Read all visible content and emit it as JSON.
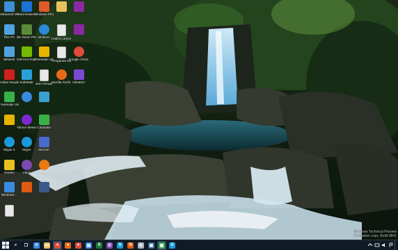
{
  "desktop": {
    "icons": [
      {
        "label": "Mohamed Ghoneim",
        "icon": "user-folder-icon",
        "color": "#3d8fd8"
      },
      {
        "label": "TeamViewer 10",
        "icon": "teamviewer-icon",
        "color": "#1b72d4"
      },
      {
        "label": "Windows Photo Viewer",
        "icon": "photo-viewer-icon",
        "color": "#e05a2a"
      },
      {
        "label": "",
        "icon": "folder-icon",
        "color": "#e8c25a"
      },
      {
        "label": "",
        "icon": "winrar-icon",
        "color": "#8a2aa0"
      },
      {
        "label": "This PC",
        "icon": "computer-icon",
        "color": "#4fa3e0"
      },
      {
        "label": "3D Vision Photo Viewer",
        "icon": "nvidia-3d-icon",
        "color": "#5a8a3a"
      },
      {
        "label": "nimbuzz",
        "icon": "nimbuzz-icon",
        "color": "#2a8ad8"
      },
      {
        "label": "Hadist Lampiran",
        "icon": "document-icon",
        "color": "#e8e8e8"
      },
      {
        "label": "",
        "icon": "winrar-icon",
        "color": "#8a2aa0"
      },
      {
        "label": "Network",
        "icon": "network-icon",
        "color": "#4fa3e0"
      },
      {
        "label": "GeForce Experience",
        "icon": "geforce-icon",
        "color": "#76b900"
      },
      {
        "label": "Freemake Video Co...",
        "icon": "freemake-icon",
        "color": "#e8b400"
      },
      {
        "label": "Pengantar Dakwa",
        "icon": "document-icon",
        "color": "#e8e8e8"
      },
      {
        "label": "Google Chrome",
        "icon": "chrome-icon",
        "color": "#dd4b39"
      },
      {
        "label": "Adobe Reader XI",
        "icon": "adobe-reader-icon",
        "color": "#d01f1f"
      },
      {
        "label": "SnibMale",
        "icon": "app-icon",
        "color": "#2aa0d8"
      },
      {
        "label": "Jam Ahmad",
        "icon": "document-icon",
        "color": "#e8e8e8"
      },
      {
        "label": "Mozilla Firefox",
        "icon": "firefox-icon",
        "color": "#e66a1a"
      },
      {
        "label": "UltraISO",
        "icon": "ultraiso-icon",
        "color": "#7a4ad0"
      },
      {
        "label": "Freemake Video Do...",
        "icon": "freemake-icon",
        "color": "#3ab04a"
      },
      {
        "label": "",
        "icon": "ie-icon",
        "color": "#3a8ae0"
      },
      {
        "label": "",
        "icon": "app-icon",
        "color": "#3aa0d0"
      },
      {
        "label": "",
        "icon": "app-icon",
        "color": "#e8b400"
      },
      {
        "label": "Yahoo! Messenger",
        "icon": "yahoo-messenger-icon",
        "color": "#7a2ad0"
      },
      {
        "label": "Camtasia",
        "icon": "camtasia-icon",
        "color": "#3ab04a"
      },
      {
        "label": "Skype 3",
        "icon": "skype-icon",
        "color": "#1a9ad8"
      },
      {
        "label": "Skype",
        "icon": "skype-icon",
        "color": "#1a9ad8"
      },
      {
        "label": "Nimzart",
        "icon": "app-icon",
        "color": "#4a6ad0"
      },
      {
        "label": "Yandex",
        "icon": "yandex-icon",
        "color": "#e8c020"
      },
      {
        "label": "Viber",
        "icon": "viber-icon",
        "color": "#7a4ab0"
      },
      {
        "label": "",
        "icon": "avast-icon",
        "color": "#e87a10"
      },
      {
        "label": "Windows...",
        "icon": "app-icon",
        "color": "#3a8ae0"
      },
      {
        "label": "",
        "icon": "office-icon",
        "color": "#e05a10"
      },
      {
        "label": "",
        "icon": "app-icon",
        "color": "#3a5a8a"
      },
      {
        "label": "",
        "icon": "document-icon",
        "color": "#e8e8e8"
      }
    ]
  },
  "watermark": {
    "line1": "Windows Technical Preview",
    "line2": "Evaluation copy. Build 9841"
  },
  "taskbar": {
    "start": "start-icon",
    "apps": [
      {
        "icon": "search-icon",
        "color": "#ffffff",
        "glyph": "⌕"
      },
      {
        "icon": "task-view-icon",
        "color": "#ffffff",
        "glyph": "❐"
      },
      {
        "icon": "ie-icon",
        "color": "#3a8ae0",
        "glyph": "e"
      },
      {
        "icon": "file-explorer-icon",
        "color": "#e8c25a",
        "glyph": "▬"
      },
      {
        "icon": "chrome-icon",
        "color": "#dd4b39",
        "glyph": "●"
      },
      {
        "icon": "firefox-icon",
        "color": "#e66a1a",
        "glyph": "●"
      },
      {
        "icon": "chrome-icon",
        "color": "#dd4b39",
        "glyph": "●"
      },
      {
        "icon": "store-icon",
        "color": "#3a8ae0",
        "glyph": "▤"
      },
      {
        "icon": "excel-icon",
        "color": "#1d7a3a",
        "glyph": "X"
      },
      {
        "icon": "viber-icon",
        "color": "#7a4ab0",
        "glyph": "✆"
      },
      {
        "icon": "skype-icon",
        "color": "#1a9ad8",
        "glyph": "S"
      },
      {
        "icon": "office-icon",
        "color": "#e05a10",
        "glyph": "N"
      },
      {
        "icon": "settings-icon",
        "color": "#aab4c0",
        "glyph": "⚙"
      },
      {
        "icon": "app-icon",
        "color": "#3a6aa0",
        "glyph": "▣"
      },
      {
        "icon": "app-icon",
        "color": "#3ab04a",
        "glyph": "▣"
      },
      {
        "icon": "skype-icon",
        "color": "#1a9ad8",
        "glyph": "S"
      }
    ],
    "tray": [
      "chevron-up-icon",
      "network-icon",
      "volume-icon",
      "flag-icon"
    ]
  }
}
